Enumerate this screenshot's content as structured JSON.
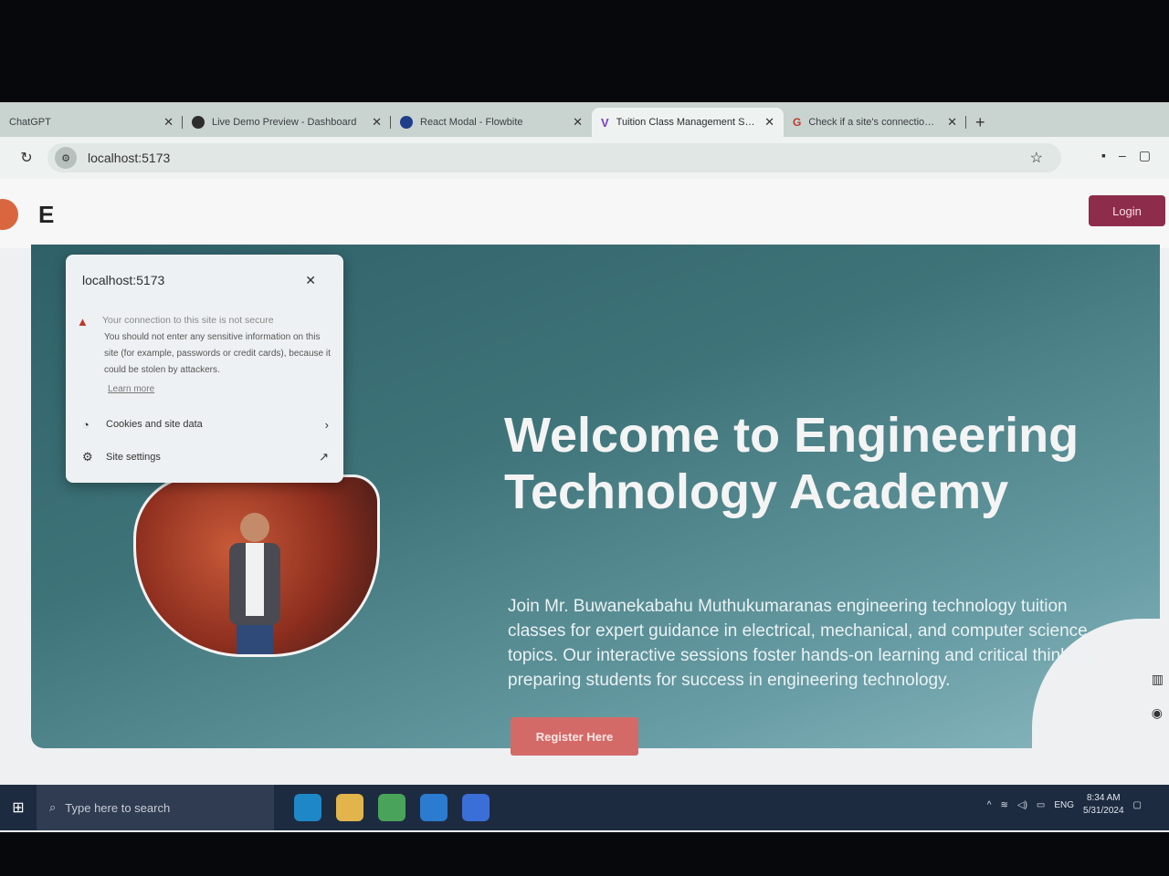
{
  "browser": {
    "tabs": [
      {
        "title": "ChatGPT",
        "active": false
      },
      {
        "title": "Live Demo Preview - Dashboard",
        "active": false
      },
      {
        "title": "React Modal - Flowbite",
        "active": false
      },
      {
        "title": "Tuition Class Management Syst",
        "active": true
      },
      {
        "title": "Check if a site's connection is s",
        "active": false
      }
    ],
    "new_tab": "+",
    "url": "localhost:5173"
  },
  "site_popup": {
    "host": "localhost:5173",
    "warning_title": "Your connection to this site is not secure",
    "warning_body": "You should not enter any sensitive information on this site (for example, passwords or credit cards), because it could be stolen by attackers.",
    "learn_more": "Learn more",
    "cookies_label": "Cookies and site data",
    "site_settings_label": "Site settings"
  },
  "navbar": {
    "brand_initial": "E",
    "login_label": "Login"
  },
  "hero": {
    "title": "Welcome to Engineering Technology Academy",
    "description": "Join Mr. Buwanekabahu Muthukumaranas engineering technology tuition classes for expert guidance in electrical, mechanical, and computer science topics. Our interactive sessions foster hands-on learning and critical thinking, preparing students for success in engineering technology.",
    "cta_label": "Register Here"
  },
  "taskbar": {
    "search_placeholder": "Type here to search",
    "language": "ENG",
    "time": "8:34 AM",
    "date": "5/31/2024"
  },
  "colors": {
    "login_button": "#8e2d4b",
    "register_button": "#d46a68",
    "hero_gradient_start": "#2f6068",
    "hero_gradient_end": "#8ab8bf"
  }
}
